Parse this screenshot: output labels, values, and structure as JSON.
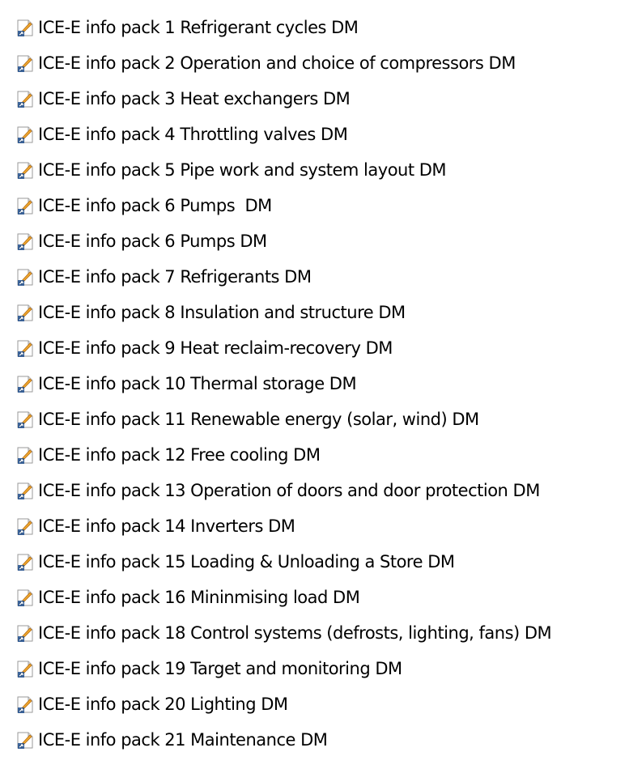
{
  "icon": "file-shortcut-document-icon",
  "colors": {
    "background": "#ffffff",
    "text": "#000000",
    "icon_accent": "#f0a830",
    "icon_shadow": "#1f4e8c"
  },
  "files": [
    {
      "name": "ICE-E info pack 1 Refrigerant cycles DM"
    },
    {
      "name": "ICE-E info pack 2 Operation and choice of compressors DM"
    },
    {
      "name": "ICE-E info pack 3 Heat exchangers DM"
    },
    {
      "name": "ICE-E info pack 4 Throttling valves DM"
    },
    {
      "name": "ICE-E info pack 5 Pipe work and system layout DM"
    },
    {
      "name": "ICE-E info pack 6 Pumps  DM"
    },
    {
      "name": "ICE-E info pack 6 Pumps DM"
    },
    {
      "name": "ICE-E info pack 7 Refrigerants DM"
    },
    {
      "name": "ICE-E info pack 8 Insulation and structure DM"
    },
    {
      "name": "ICE-E info pack 9 Heat reclaim-recovery DM"
    },
    {
      "name": "ICE-E info pack 10 Thermal storage DM"
    },
    {
      "name": "ICE-E info pack 11 Renewable energy (solar, wind) DM"
    },
    {
      "name": "ICE-E info pack 12 Free cooling DM"
    },
    {
      "name": "ICE-E info pack 13 Operation of doors and door protection DM"
    },
    {
      "name": "ICE-E info pack 14 Inverters DM"
    },
    {
      "name": "ICE-E info pack 15 Loading & Unloading a Store DM"
    },
    {
      "name": "ICE-E info pack 16 Mininmising load DM"
    },
    {
      "name": "ICE-E info pack 18 Control systems (defrosts, lighting, fans) DM"
    },
    {
      "name": "ICE-E info pack 19 Target and monitoring DM"
    },
    {
      "name": "ICE-E info pack 20 Lighting DM"
    },
    {
      "name": "ICE-E info pack 21 Maintenance DM"
    }
  ]
}
